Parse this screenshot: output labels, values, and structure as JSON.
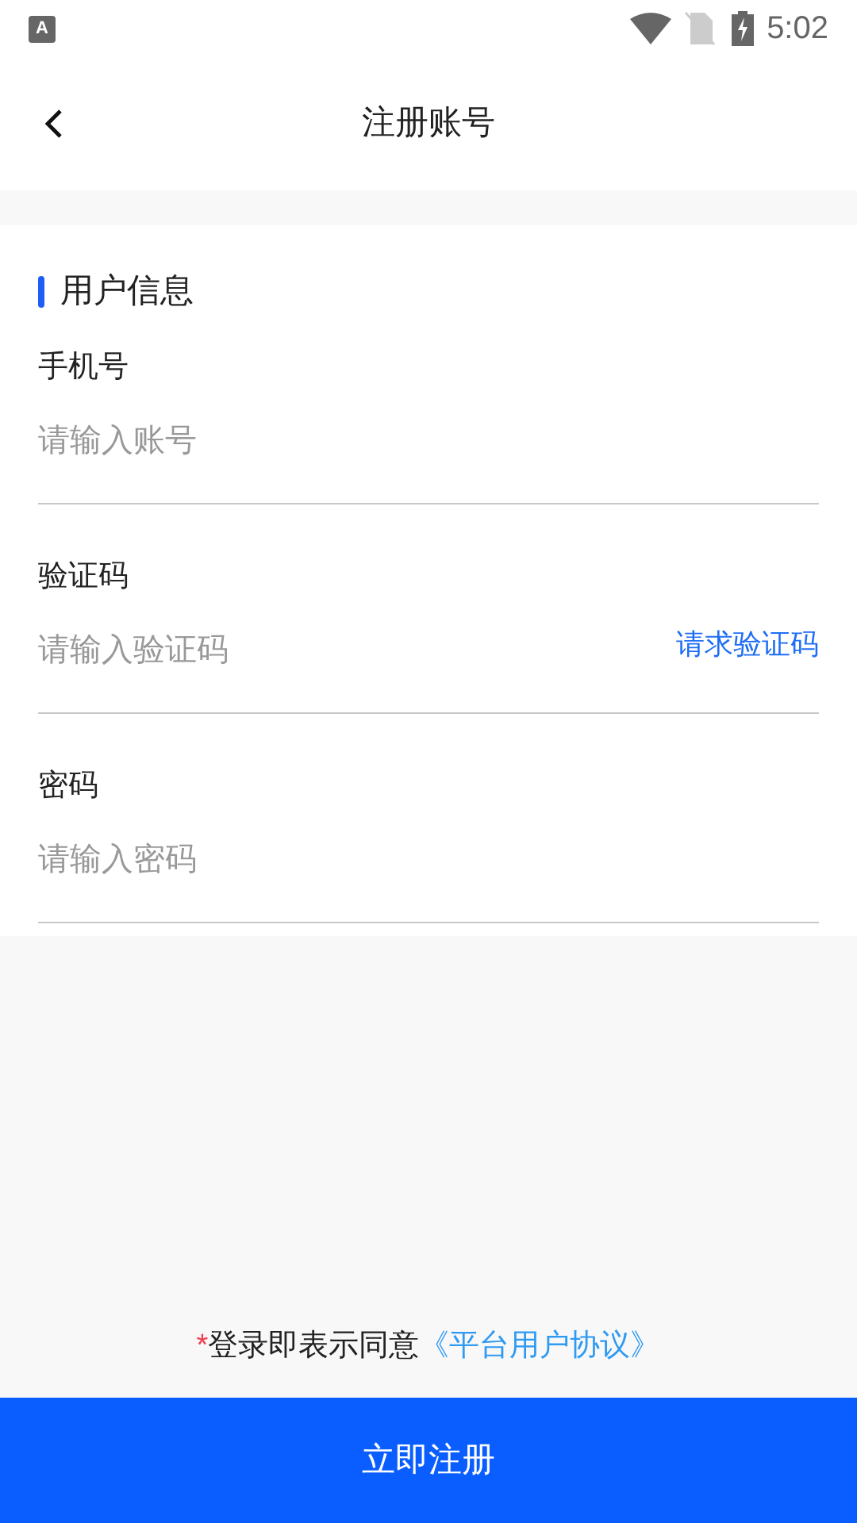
{
  "status_bar": {
    "notification_glyph": "A",
    "time": "5:02"
  },
  "header": {
    "title": "注册账号"
  },
  "section": {
    "title": "用户信息"
  },
  "fields": [
    {
      "label": "手机号",
      "placeholder": "请输入账号"
    },
    {
      "label": "验证码",
      "placeholder": "请输入验证码",
      "action": "请求验证码"
    },
    {
      "label": "密码",
      "placeholder": "请输入密码"
    }
  ],
  "agreement": {
    "mark": "*",
    "text": "登录即表示同意",
    "link": "《平台用户协议》"
  },
  "submit_button": "立即注册"
}
